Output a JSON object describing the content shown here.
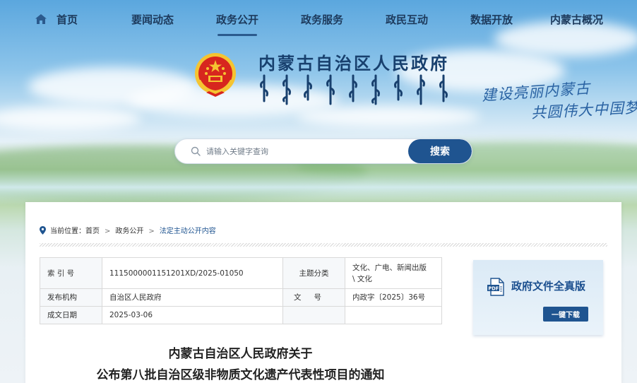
{
  "nav": {
    "items": [
      {
        "label": "首页"
      },
      {
        "label": "要闻动态"
      },
      {
        "label": "政务公开"
      },
      {
        "label": "政务服务"
      },
      {
        "label": "政民互动"
      },
      {
        "label": "数据开放"
      },
      {
        "label": "内蒙古概况"
      }
    ],
    "active_index": 2
  },
  "header": {
    "title": "内蒙古自治区人民政府",
    "slogan_line1": "建设亮丽内蒙古",
    "slogan_line2": "共圆伟大中国梦"
  },
  "search": {
    "placeholder": "请输入关键字查询",
    "button_label": "搜索"
  },
  "breadcrumb": {
    "prefix": "当前位置：",
    "items": [
      "首页",
      "政务公开",
      "法定主动公开内容"
    ],
    "separator": ">"
  },
  "info": {
    "index_label": "索 引 号",
    "index_value": "11150000011512​01XD/2025-01050",
    "topic_label": "主题分类",
    "topic_value_line1": "文化、广电、新闻出版",
    "topic_value_line2": "\\ 文化",
    "issuer_label": "发布机构",
    "issuer_value": "自治区人民政府",
    "docno_label": "文号",
    "docno_value": "内政字〔2025〕36号",
    "date_label": "成文日期",
    "date_value": "2025-03-06"
  },
  "download": {
    "title": "政府文件全真版",
    "button_label": "一键下载"
  },
  "article": {
    "title_line1": "内蒙古自治区人民政府关于",
    "title_line2": "公布第八批自治区级非物质文化遗产代表性项目的通知"
  },
  "colors": {
    "brand_blue": "#1f5490",
    "nav_text": "#1d3a5c",
    "title_blue": "#18406e",
    "emblem_red": "#d7261e",
    "emblem_gold": "#f5c431"
  },
  "icons": {
    "home": "home-icon",
    "search": "search-icon",
    "location": "location-pin-icon",
    "pdf": "pdf-file-icon",
    "emblem": "national-emblem"
  }
}
